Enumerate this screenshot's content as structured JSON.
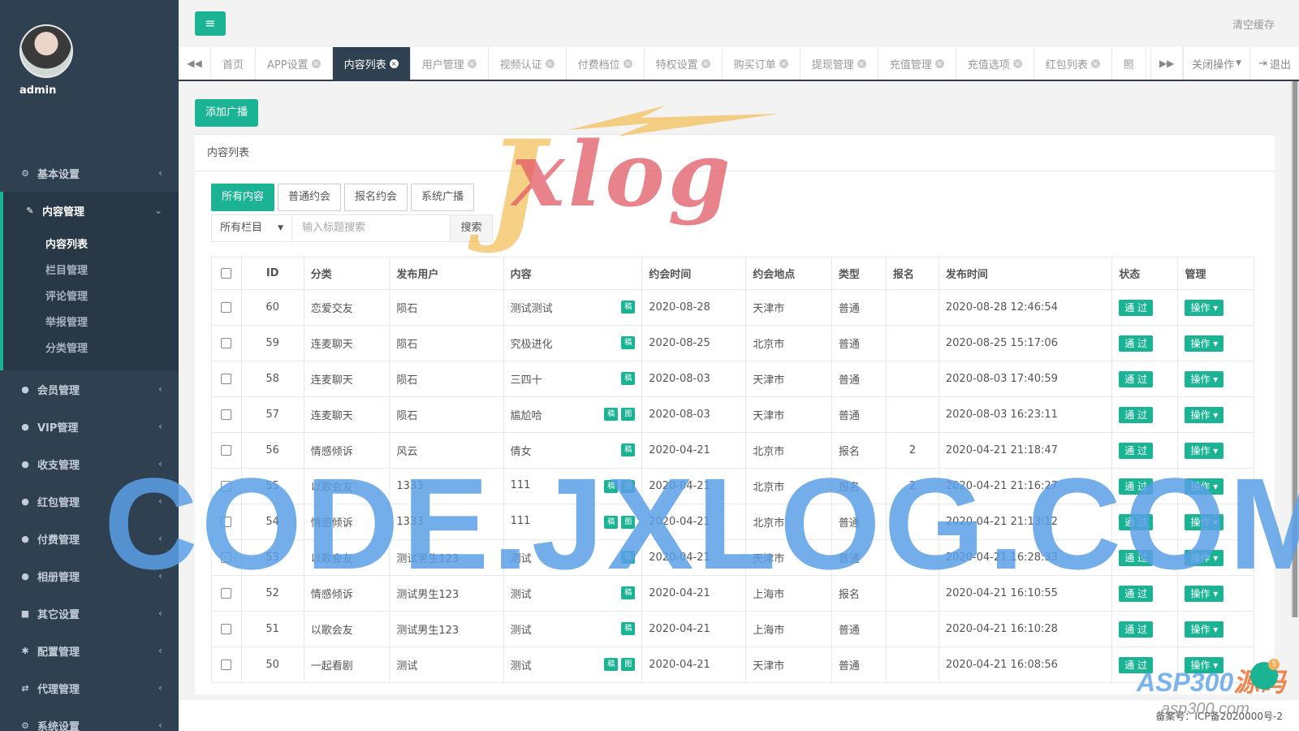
{
  "profile": {
    "name": "admin"
  },
  "sidebar": {
    "items": [
      {
        "icon": "gear-icon",
        "glyph": "⚙",
        "label": "基本设置"
      },
      {
        "icon": "edit-icon",
        "glyph": "✎",
        "label": "内容管理",
        "active": true,
        "children": [
          {
            "label": "内容列表",
            "current": true
          },
          {
            "label": "栏目管理"
          },
          {
            "label": "评论管理"
          },
          {
            "label": "举报管理"
          },
          {
            "label": "分类管理"
          }
        ]
      },
      {
        "icon": "user-icon",
        "glyph": "●",
        "label": "会员管理"
      },
      {
        "icon": "user-icon",
        "glyph": "●",
        "label": "VIP管理"
      },
      {
        "icon": "user-icon",
        "glyph": "●",
        "label": "收支管理"
      },
      {
        "icon": "user-icon",
        "glyph": "●",
        "label": "红包管理"
      },
      {
        "icon": "user-icon",
        "glyph": "●",
        "label": "付费管理"
      },
      {
        "icon": "user-icon",
        "glyph": "●",
        "label": "相册管理"
      },
      {
        "icon": "book-icon",
        "glyph": "■",
        "label": "其它设置"
      },
      {
        "icon": "asterisk-icon",
        "glyph": "✱",
        "label": "配置管理"
      },
      {
        "icon": "exchange-icon",
        "glyph": "⇄",
        "label": "代理管理"
      },
      {
        "icon": "gears-icon",
        "glyph": "⚙",
        "label": "系统设置"
      }
    ]
  },
  "topbar": {
    "clear_cache": "清空缓存"
  },
  "tabs": [
    {
      "label": "首页",
      "closable": false
    },
    {
      "label": "APP设置",
      "closable": true
    },
    {
      "label": "内容列表",
      "closable": true,
      "active": true
    },
    {
      "label": "用户管理",
      "closable": true
    },
    {
      "label": "视频认证",
      "closable": true
    },
    {
      "label": "付费档位",
      "closable": true
    },
    {
      "label": "特权设置",
      "closable": true
    },
    {
      "label": "购买订单",
      "closable": true
    },
    {
      "label": "提现管理",
      "closable": true
    },
    {
      "label": "充值管理",
      "closable": true
    },
    {
      "label": "充值选项",
      "closable": true
    },
    {
      "label": "红包列表",
      "closable": true
    },
    {
      "label": "照",
      "closable": false
    }
  ],
  "tab_actions": {
    "close_ops": "关闭操作",
    "logout": "退出"
  },
  "content": {
    "add_button": "添加广播",
    "panel_title": "内容列表",
    "filters": [
      "所有内容",
      "普通约会",
      "报名约会",
      "系统广播"
    ],
    "category_select": "所有栏目",
    "search_placeholder": "输入标题搜索",
    "search_button": "搜索"
  },
  "table": {
    "headers": [
      "ID",
      "分类",
      "发布用户",
      "内容",
      "约会时间",
      "约会地点",
      "类型",
      "报名",
      "发布时间",
      "状态",
      "管理"
    ],
    "rows": [
      {
        "id": "60",
        "category": "恋爱交友",
        "user": "陨石",
        "content": "测试测试",
        "tags": [
          "稿"
        ],
        "date": "2020-08-28",
        "place": "天津市",
        "type": "普通",
        "signup": "",
        "published": "2020-08-28 12:46:54",
        "status": "通 过",
        "action": "操作"
      },
      {
        "id": "59",
        "category": "连麦聊天",
        "user": "陨石",
        "content": "究极进化",
        "tags": [
          "稿"
        ],
        "date": "2020-08-25",
        "place": "北京市",
        "type": "普通",
        "signup": "",
        "published": "2020-08-25 15:17:06",
        "status": "通 过",
        "action": "操作"
      },
      {
        "id": "58",
        "category": "连麦聊天",
        "user": "陨石",
        "content": "三四十",
        "tags": [
          "稿"
        ],
        "date": "2020-08-03",
        "place": "天津市",
        "type": "普通",
        "signup": "",
        "published": "2020-08-03 17:40:59",
        "status": "通 过",
        "action": "操作"
      },
      {
        "id": "57",
        "category": "连麦聊天",
        "user": "陨石",
        "content": "尴尬哈",
        "tags": [
          "稿",
          "图"
        ],
        "date": "2020-08-03",
        "place": "天津市",
        "type": "普通",
        "signup": "",
        "published": "2020-08-03 16:23:11",
        "status": "通 过",
        "action": "操作"
      },
      {
        "id": "56",
        "category": "情感倾诉",
        "user": "风云",
        "content": "倩女",
        "tags": [
          "稿"
        ],
        "date": "2020-04-21",
        "place": "北京市",
        "type": "报名",
        "signup": "2",
        "published": "2020-04-21 21:18:47",
        "status": "通 过",
        "action": "操作"
      },
      {
        "id": "55",
        "category": "以歌会友",
        "user": "1333",
        "content": "111",
        "tags": [
          "稿",
          "图"
        ],
        "date": "2020-04-21",
        "place": "北京市",
        "type": "报名",
        "signup": "2",
        "published": "2020-04-21 21:16:27",
        "status": "通 过",
        "action": "操作"
      },
      {
        "id": "54",
        "category": "情感倾诉",
        "user": "1333",
        "content": "111",
        "tags": [
          "稿",
          "图"
        ],
        "date": "2020-04-21",
        "place": "北京市",
        "type": "普通",
        "signup": "",
        "published": "2020-04-21 21:13:12",
        "status": "通 过",
        "action": "操作"
      },
      {
        "id": "53",
        "category": "以歌会友",
        "user": "测试男生123",
        "content": "测试",
        "tags": [
          "稿"
        ],
        "date": "2020-04-21",
        "place": "天津市",
        "type": "普通",
        "signup": "",
        "published": "2020-04-21 16:28:33",
        "status": "通 过",
        "action": "操作"
      },
      {
        "id": "52",
        "category": "情感倾诉",
        "user": "测试男生123",
        "content": "测试",
        "tags": [
          "稿"
        ],
        "date": "2020-04-21",
        "place": "上海市",
        "type": "报名",
        "signup": "",
        "published": "2020-04-21 16:10:55",
        "status": "通 过",
        "action": "操作"
      },
      {
        "id": "51",
        "category": "以歌会友",
        "user": "测试男生123",
        "content": "测试",
        "tags": [
          "稿"
        ],
        "date": "2020-04-21",
        "place": "上海市",
        "type": "普通",
        "signup": "",
        "published": "2020-04-21 16:10:28",
        "status": "通 过",
        "action": "操作"
      },
      {
        "id": "50",
        "category": "一起看剧",
        "user": "测试",
        "content": "测试",
        "tags": [
          "稿",
          "图"
        ],
        "date": "2020-04-21",
        "place": "天津市",
        "type": "普通",
        "signup": "",
        "published": "2020-04-21 16:08:56",
        "status": "通 过",
        "action": "操作"
      }
    ]
  },
  "footer": {
    "text": "备案号：ICP备2020000号-2"
  },
  "chat_badge_count": "5",
  "watermarks": {
    "logo": "Jxlog",
    "code": "CODE.JXLOG.COM",
    "asp": "ASP300",
    "asp_accent": "源码",
    "asp_url": "asp300.com"
  },
  "colors": {
    "accent": "#1ab394",
    "sidebar": "#2f4050",
    "sidebar_active": "#293846"
  }
}
